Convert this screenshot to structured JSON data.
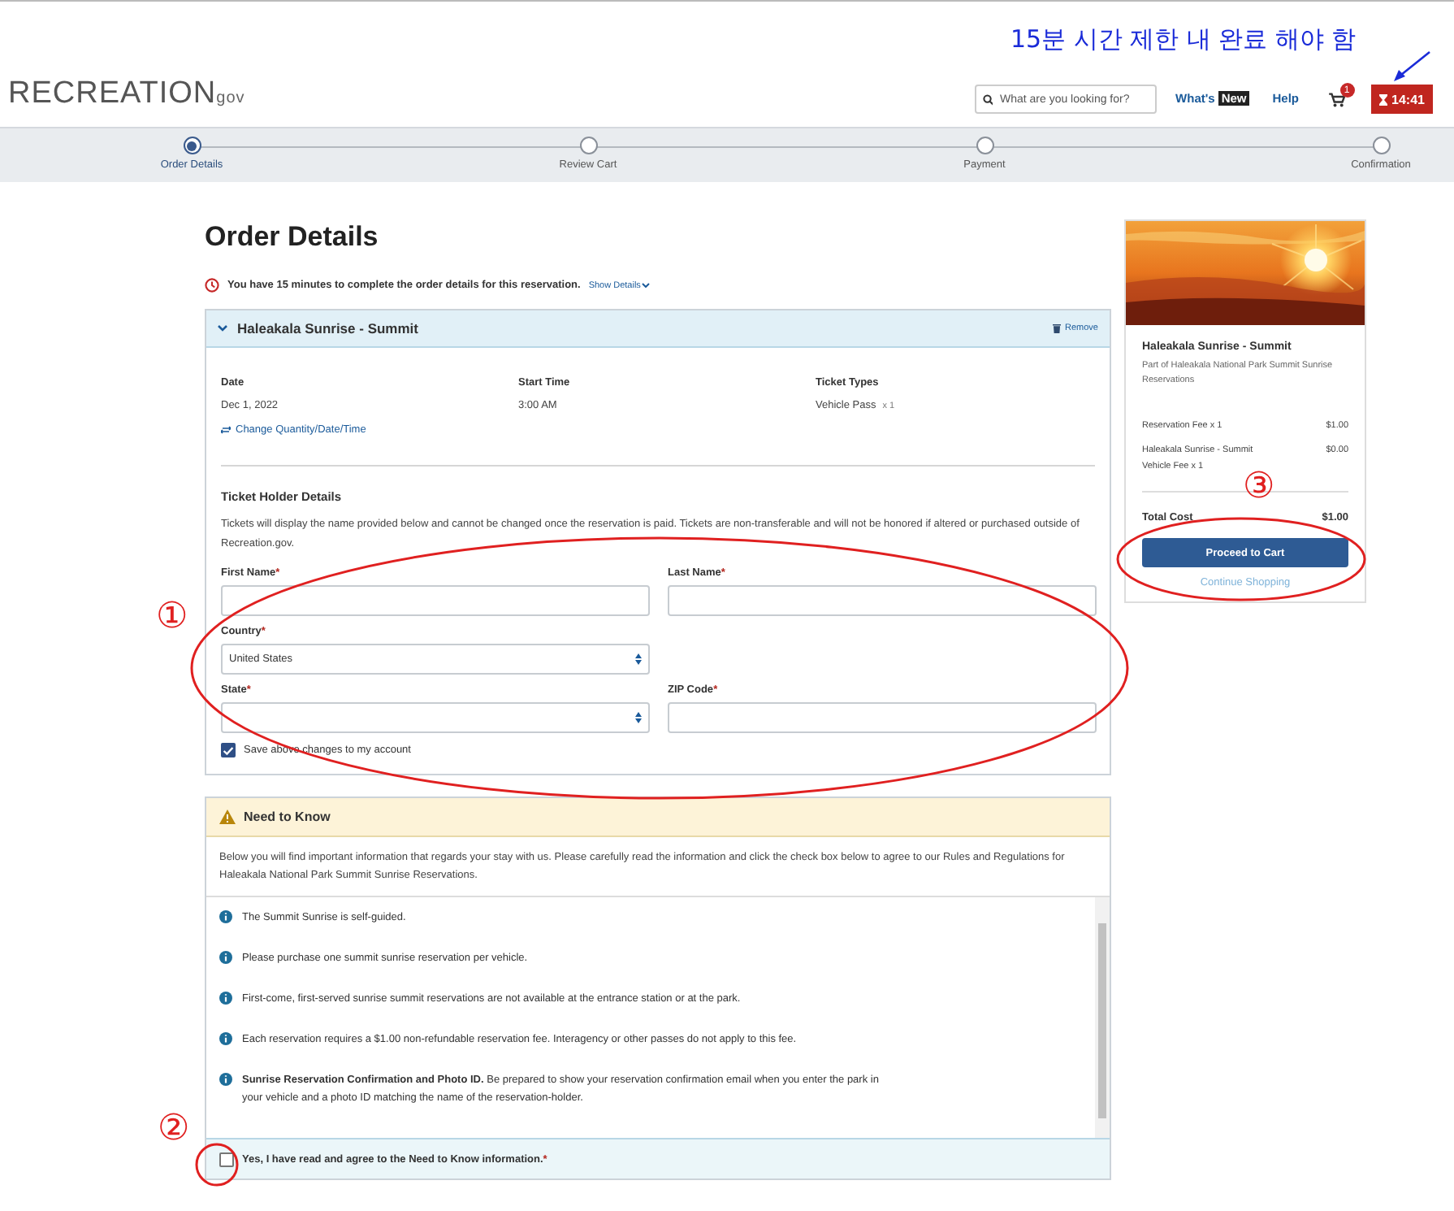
{
  "header": {
    "logo": "RECREATION",
    "logo_suffix": "gov",
    "search": {
      "placeholder": "What are you looking for?"
    },
    "whats": "What's",
    "new_badge": "New",
    "help": "Help",
    "cart_count": "1",
    "timer": "14:41"
  },
  "steps": [
    {
      "label": "Order Details",
      "selected": true
    },
    {
      "label": "Review Cart",
      "selected": false
    },
    {
      "label": "Payment",
      "selected": false
    },
    {
      "label": "Confirmation",
      "selected": false
    }
  ],
  "page_title": "Order Details",
  "notice": {
    "text": "You have 15 minutes to complete the order details for this reservation.",
    "link": "Show Details"
  },
  "reservation": {
    "title": "Haleakala Sunrise - Summit",
    "expanded": true,
    "remove": "Remove",
    "details": [
      {
        "label": "Date",
        "value": "Dec 1, 2022"
      },
      {
        "label": "Start Time",
        "value": "3:00 AM"
      },
      {
        "label": "Ticket Types",
        "value": "Vehicle Pass",
        "qty": "x 1"
      }
    ],
    "change_link": "Change Quantity/Date/Time"
  },
  "ticket_holder": {
    "title": "Ticket Holder Details",
    "note": "Tickets will display the name provided below and cannot be changed once the reservation is paid. Tickets are non-transferable and will not be honored if altered or purchased outside of Recreation.gov.",
    "field_rows": [
      [
        {
          "label": "First Name",
          "mark": "*",
          "kind": "text"
        },
        {
          "label": "Last Name",
          "mark": "*",
          "kind": "text"
        }
      ],
      [
        {
          "label": "Country",
          "mark": "*",
          "kind": "select",
          "value": "United States"
        }
      ],
      [
        {
          "label": "State",
          "mark": "*",
          "kind": "select"
        },
        {
          "label": "ZIP Code",
          "mark": "*",
          "kind": "text"
        }
      ]
    ],
    "save": {
      "label": "Save above changes to my account",
      "checked": true
    }
  },
  "need_to_know": {
    "title": "Need to Know",
    "intro": "Below you will find important information that regards your stay with us. Please carefully read the information and click the check box below to agree to our Rules and Regulations for Haleakala National Park Summit Sunrise Reservations.",
    "items": [
      "The Summit Sunrise is self-guided.",
      "Please purchase one summit sunrise reservation per vehicle.",
      "First-come, first-served sunrise summit reservations are not available at the entrance station or at the park.",
      "Each reservation requires a $1.00 non-refundable reservation fee. Interagency or other passes do not apply to this fee.",
      "**Sunrise Reservation Confirmation and Photo ID.** Be prepared to show your reservation confirmation email when you enter the park in your vehicle and a photo ID matching the name of the reservation-holder."
    ],
    "agree": {
      "label": "Yes, I have read and agree to the Need to Know information.",
      "mark": "*",
      "checked": false
    }
  },
  "summary": {
    "title": "Haleakala Sunrise - Summit",
    "subtitle": "Part of Haleakala National Park Summit Sunrise Reservations",
    "fees": [
      {
        "label": "Reservation Fee x 1",
        "amount": "$1.00"
      },
      {
        "label": "Haleakala Sunrise - Summit Vehicle Fee x 1",
        "amount": "$0.00"
      }
    ],
    "total_label": "Total Cost",
    "total": "$1.00",
    "primary": "Proceed to Cart",
    "secondary": "Continue Shopping"
  },
  "annotations": {
    "note": "15분 시간 제한 내 완료 해야 함",
    "markers": [
      "①",
      "②",
      "③"
    ]
  }
}
